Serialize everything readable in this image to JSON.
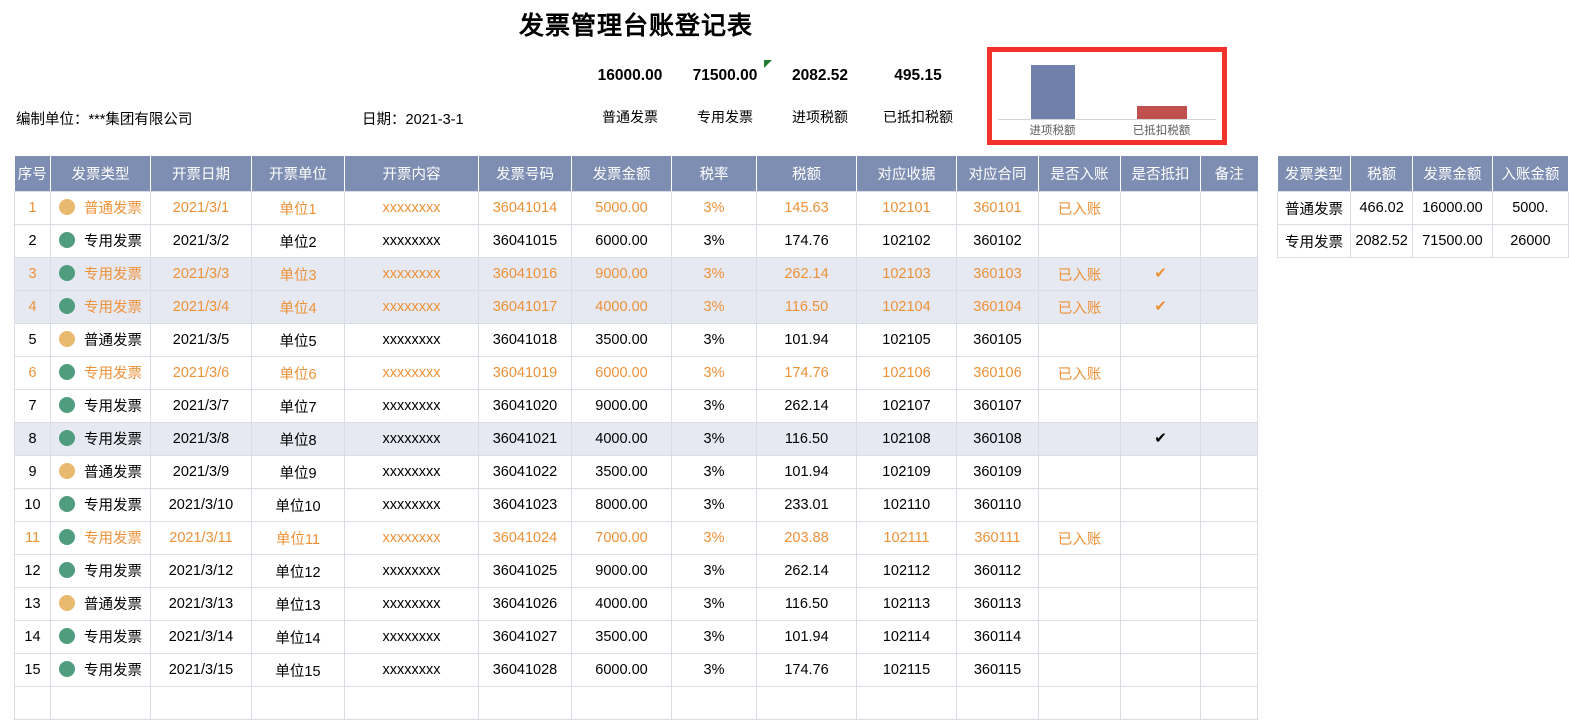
{
  "title": "发票管理台账登记表",
  "meta": {
    "org_label": "编制单位：",
    "org_value": "***集团有限公司",
    "date_text": "日期：2021-3-1"
  },
  "kpis": [
    {
      "value": "16000.00",
      "label": "普通发票"
    },
    {
      "value": "71500.00",
      "label": "专用发票"
    },
    {
      "value": "2082.52",
      "label": "进项税额"
    },
    {
      "value": "495.15",
      "label": "已抵扣税额"
    }
  ],
  "chart_data": {
    "type": "bar",
    "title": "",
    "categories": [
      "进项税额",
      "已抵扣税额"
    ],
    "values": [
      2082.52,
      495.15
    ],
    "series": [
      {
        "name": "税额",
        "values": [
          2082.52,
          495.15
        ]
      }
    ],
    "colors": [
      "#6f81ab",
      "#c0504d"
    ],
    "xlabel": "",
    "ylabel": "",
    "ylim": [
      0,
      2082.52
    ],
    "grid": false,
    "legend": "none",
    "highlight_border_color": "#f4322c"
  },
  "ledger": {
    "headers": [
      "序号",
      "发票类型",
      "开票日期",
      "开票单位",
      "开票内容",
      "发票号码",
      "发票金额",
      "税率",
      "税额",
      "对应收据",
      "对应合同",
      "是否入账",
      "是否抵扣",
      "备注"
    ],
    "rows": [
      {
        "idx": "1",
        "type": "普通发票",
        "dot": "normal",
        "date": "2021/3/1",
        "unit": "单位1",
        "content": "xxxxxxxx",
        "number": "36041014",
        "amount": "5000.00",
        "rate": "3%",
        "tax": "145.63",
        "receipt": "102101",
        "contract": "360101",
        "booked": "已入账",
        "deducted": "",
        "note": "",
        "highlight": true,
        "band": false
      },
      {
        "idx": "2",
        "type": "专用发票",
        "dot": "special",
        "date": "2021/3/2",
        "unit": "单位2",
        "content": "xxxxxxxx",
        "number": "36041015",
        "amount": "6000.00",
        "rate": "3%",
        "tax": "174.76",
        "receipt": "102102",
        "contract": "360102",
        "booked": "",
        "deducted": "",
        "note": "",
        "highlight": false,
        "band": false
      },
      {
        "idx": "3",
        "type": "专用发票",
        "dot": "special",
        "date": "2021/3/3",
        "unit": "单位3",
        "content": "xxxxxxxx",
        "number": "36041016",
        "amount": "9000.00",
        "rate": "3%",
        "tax": "262.14",
        "receipt": "102103",
        "contract": "360103",
        "booked": "已入账",
        "deducted": "✔",
        "note": "",
        "highlight": true,
        "band": true
      },
      {
        "idx": "4",
        "type": "专用发票",
        "dot": "special",
        "date": "2021/3/4",
        "unit": "单位4",
        "content": "xxxxxxxx",
        "number": "36041017",
        "amount": "4000.00",
        "rate": "3%",
        "tax": "116.50",
        "receipt": "102104",
        "contract": "360104",
        "booked": "已入账",
        "deducted": "✔",
        "note": "",
        "highlight": true,
        "band": true
      },
      {
        "idx": "5",
        "type": "普通发票",
        "dot": "normal",
        "date": "2021/3/5",
        "unit": "单位5",
        "content": "xxxxxxxx",
        "number": "36041018",
        "amount": "3500.00",
        "rate": "3%",
        "tax": "101.94",
        "receipt": "102105",
        "contract": "360105",
        "booked": "",
        "deducted": "",
        "note": "",
        "highlight": false,
        "band": false
      },
      {
        "idx": "6",
        "type": "专用发票",
        "dot": "special",
        "date": "2021/3/6",
        "unit": "单位6",
        "content": "xxxxxxxx",
        "number": "36041019",
        "amount": "6000.00",
        "rate": "3%",
        "tax": "174.76",
        "receipt": "102106",
        "contract": "360106",
        "booked": "已入账",
        "deducted": "",
        "note": "",
        "highlight": true,
        "band": false
      },
      {
        "idx": "7",
        "type": "专用发票",
        "dot": "special",
        "date": "2021/3/7",
        "unit": "单位7",
        "content": "xxxxxxxx",
        "number": "36041020",
        "amount": "9000.00",
        "rate": "3%",
        "tax": "262.14",
        "receipt": "102107",
        "contract": "360107",
        "booked": "",
        "deducted": "",
        "note": "",
        "highlight": false,
        "band": false
      },
      {
        "idx": "8",
        "type": "专用发票",
        "dot": "special",
        "date": "2021/3/8",
        "unit": "单位8",
        "content": "xxxxxxxx",
        "number": "36041021",
        "amount": "4000.00",
        "rate": "3%",
        "tax": "116.50",
        "receipt": "102108",
        "contract": "360108",
        "booked": "",
        "deducted": "✔",
        "note": "",
        "highlight": false,
        "band": true
      },
      {
        "idx": "9",
        "type": "普通发票",
        "dot": "normal",
        "date": "2021/3/9",
        "unit": "单位9",
        "content": "xxxxxxxx",
        "number": "36041022",
        "amount": "3500.00",
        "rate": "3%",
        "tax": "101.94",
        "receipt": "102109",
        "contract": "360109",
        "booked": "",
        "deducted": "",
        "note": "",
        "highlight": false,
        "band": false
      },
      {
        "idx": "10",
        "type": "专用发票",
        "dot": "special",
        "date": "2021/3/10",
        "unit": "单位10",
        "content": "xxxxxxxx",
        "number": "36041023",
        "amount": "8000.00",
        "rate": "3%",
        "tax": "233.01",
        "receipt": "102110",
        "contract": "360110",
        "booked": "",
        "deducted": "",
        "note": "",
        "highlight": false,
        "band": false
      },
      {
        "idx": "11",
        "type": "专用发票",
        "dot": "special",
        "date": "2021/3/11",
        "unit": "单位11",
        "content": "xxxxxxxx",
        "number": "36041024",
        "amount": "7000.00",
        "rate": "3%",
        "tax": "203.88",
        "receipt": "102111",
        "contract": "360111",
        "booked": "已入账",
        "deducted": "",
        "note": "",
        "highlight": true,
        "band": false
      },
      {
        "idx": "12",
        "type": "专用发票",
        "dot": "special",
        "date": "2021/3/12",
        "unit": "单位12",
        "content": "xxxxxxxx",
        "number": "36041025",
        "amount": "9000.00",
        "rate": "3%",
        "tax": "262.14",
        "receipt": "102112",
        "contract": "360112",
        "booked": "",
        "deducted": "",
        "note": "",
        "highlight": false,
        "band": false
      },
      {
        "idx": "13",
        "type": "普通发票",
        "dot": "normal",
        "date": "2021/3/13",
        "unit": "单位13",
        "content": "xxxxxxxx",
        "number": "36041026",
        "amount": "4000.00",
        "rate": "3%",
        "tax": "116.50",
        "receipt": "102113",
        "contract": "360113",
        "booked": "",
        "deducted": "",
        "note": "",
        "highlight": false,
        "band": false
      },
      {
        "idx": "14",
        "type": "专用发票",
        "dot": "special",
        "date": "2021/3/14",
        "unit": "单位14",
        "content": "xxxxxxxx",
        "number": "36041027",
        "amount": "3500.00",
        "rate": "3%",
        "tax": "101.94",
        "receipt": "102114",
        "contract": "360114",
        "booked": "",
        "deducted": "",
        "note": "",
        "highlight": false,
        "band": false
      },
      {
        "idx": "15",
        "type": "专用发票",
        "dot": "special",
        "date": "2021/3/15",
        "unit": "单位15",
        "content": "xxxxxxxx",
        "number": "36041028",
        "amount": "6000.00",
        "rate": "3%",
        "tax": "174.76",
        "receipt": "102115",
        "contract": "360115",
        "booked": "",
        "deducted": "",
        "note": "",
        "highlight": false,
        "band": false
      },
      {
        "idx": "",
        "type": "",
        "dot": "",
        "date": "",
        "unit": "",
        "content": "",
        "number": "",
        "amount": "",
        "rate": "",
        "tax": "",
        "receipt": "",
        "contract": "",
        "booked": "",
        "deducted": "",
        "note": "",
        "highlight": false,
        "band": false
      }
    ]
  },
  "summary": {
    "headers": [
      "发票类型",
      "税额",
      "发票金额",
      "入账金额"
    ],
    "rows": [
      {
        "type": "普通发票",
        "tax": "466.02",
        "amount": "16000.00",
        "booked": "5000."
      },
      {
        "type": "专用发票",
        "tax": "2082.52",
        "amount": "71500.00",
        "booked": "26000"
      }
    ]
  }
}
